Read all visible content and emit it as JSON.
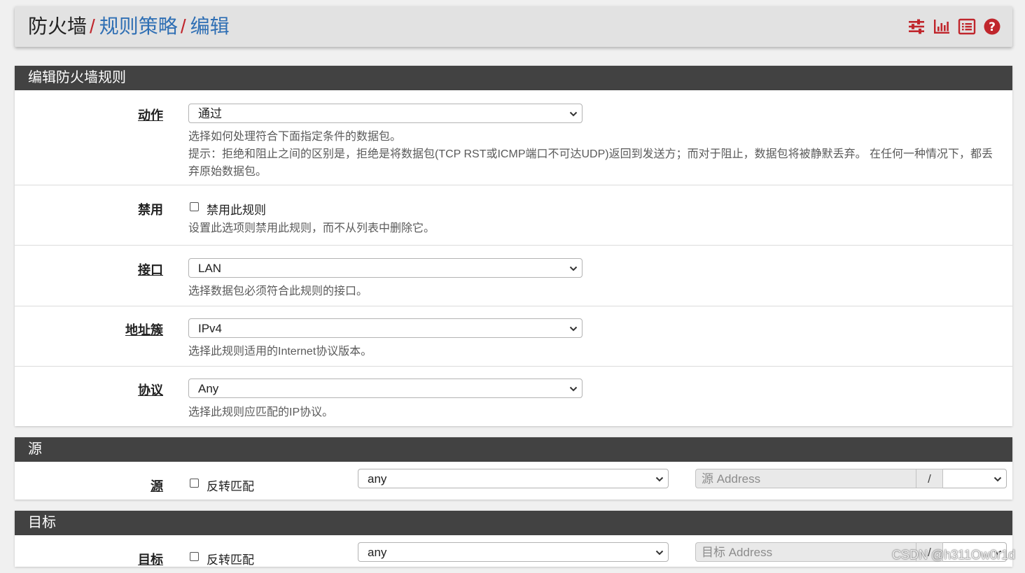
{
  "breadcrumb": {
    "root": "防火墙",
    "sep1": "/",
    "level2": "规则策略",
    "sep2": "/",
    "level3": "编辑"
  },
  "top_icons": [
    "sliders-icon",
    "bar-chart-icon",
    "list-icon",
    "help-icon"
  ],
  "accent_color": "#c0262c",
  "link_color": "#2f6fb4",
  "panels": {
    "edit": {
      "title": "编辑防火墙规则",
      "action": {
        "label": "动作",
        "value": "通过",
        "help1": "选择如何处理符合下面指定条件的数据包。",
        "help2": "提示：拒绝和阻止之间的区别是，拒绝是将数据包(TCP RST或ICMP端口不可达UDP)返回到发送方；而对于阻止，数据包将被静默丢弃。 在任何一种情况下，都丢弃原始数据包。"
      },
      "disable": {
        "label": "禁用",
        "checkbox_label": "禁用此规则",
        "checked": false,
        "help": "设置此选项则禁用此规则，而不从列表中删除它。"
      },
      "interface": {
        "label": "接口",
        "value": "LAN",
        "help": "选择数据包必须符合此规则的接口。"
      },
      "family": {
        "label": "地址簇",
        "value": "IPv4",
        "help": "选择此规则适用的Internet协议版本。"
      },
      "protocol": {
        "label": "协议",
        "value": "Any",
        "help": "选择此规则应匹配的IP协议。"
      }
    },
    "source": {
      "title": "源",
      "label": "源",
      "invert_label": "反转匹配",
      "type_value": "any",
      "address_placeholder": "源 Address",
      "slash": "/"
    },
    "destination": {
      "title": "目标",
      "label": "目标",
      "invert_label": "反转匹配",
      "type_value": "any",
      "address_placeholder": "目标 Address",
      "slash": "/"
    }
  },
  "watermark": "CSDN @h311Ow0r1d"
}
